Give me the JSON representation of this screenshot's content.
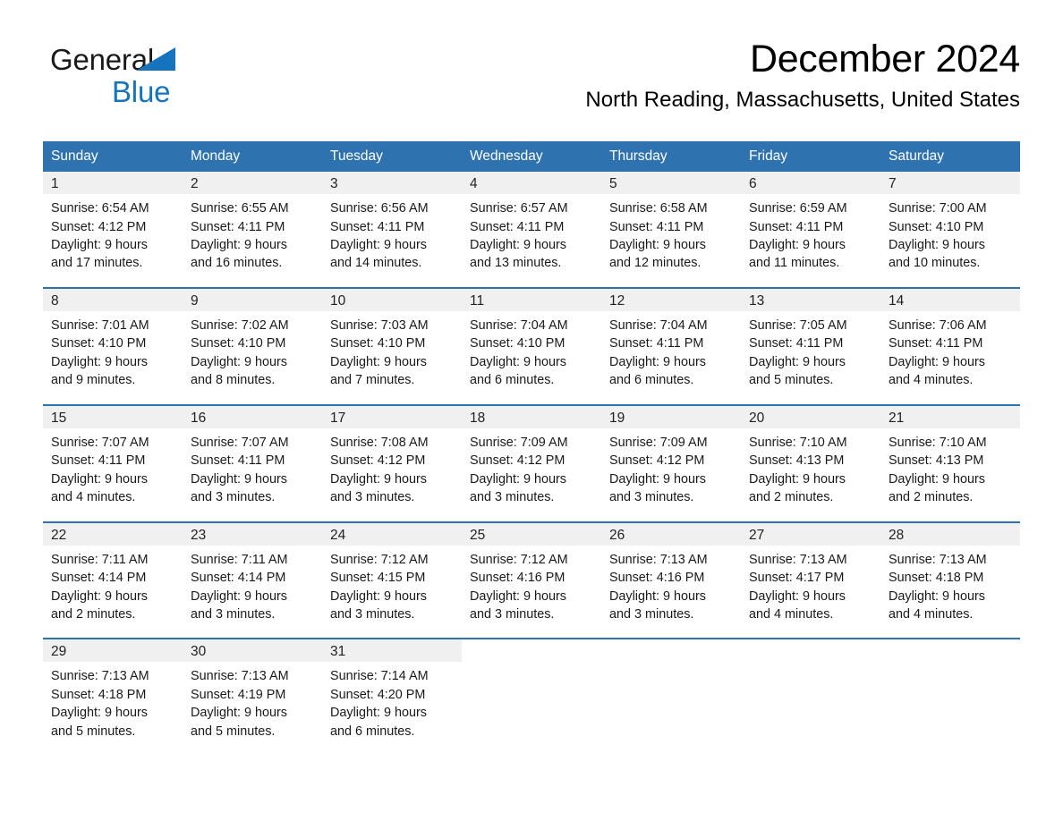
{
  "brand": {
    "name_part1": "General",
    "name_part2": "Blue",
    "triangle_color": "#1574bd"
  },
  "header": {
    "month_title": "December 2024",
    "location": "North Reading, Massachusetts, United States"
  },
  "theme": {
    "header_blue": "#2e72b0",
    "daynum_band": "#f0f0f0",
    "text": "#1a1a1a"
  },
  "calendar": {
    "weekday_headers": [
      "Sunday",
      "Monday",
      "Tuesday",
      "Wednesday",
      "Thursday",
      "Friday",
      "Saturday"
    ],
    "weeks": [
      [
        {
          "day": "1",
          "sunrise": "Sunrise: 6:54 AM",
          "sunset": "Sunset: 4:12 PM",
          "daylight_line1": "Daylight: 9 hours",
          "daylight_line2": "and 17 minutes."
        },
        {
          "day": "2",
          "sunrise": "Sunrise: 6:55 AM",
          "sunset": "Sunset: 4:11 PM",
          "daylight_line1": "Daylight: 9 hours",
          "daylight_line2": "and 16 minutes."
        },
        {
          "day": "3",
          "sunrise": "Sunrise: 6:56 AM",
          "sunset": "Sunset: 4:11 PM",
          "daylight_line1": "Daylight: 9 hours",
          "daylight_line2": "and 14 minutes."
        },
        {
          "day": "4",
          "sunrise": "Sunrise: 6:57 AM",
          "sunset": "Sunset: 4:11 PM",
          "daylight_line1": "Daylight: 9 hours",
          "daylight_line2": "and 13 minutes."
        },
        {
          "day": "5",
          "sunrise": "Sunrise: 6:58 AM",
          "sunset": "Sunset: 4:11 PM",
          "daylight_line1": "Daylight: 9 hours",
          "daylight_line2": "and 12 minutes."
        },
        {
          "day": "6",
          "sunrise": "Sunrise: 6:59 AM",
          "sunset": "Sunset: 4:11 PM",
          "daylight_line1": "Daylight: 9 hours",
          "daylight_line2": "and 11 minutes."
        },
        {
          "day": "7",
          "sunrise": "Sunrise: 7:00 AM",
          "sunset": "Sunset: 4:10 PM",
          "daylight_line1": "Daylight: 9 hours",
          "daylight_line2": "and 10 minutes."
        }
      ],
      [
        {
          "day": "8",
          "sunrise": "Sunrise: 7:01 AM",
          "sunset": "Sunset: 4:10 PM",
          "daylight_line1": "Daylight: 9 hours",
          "daylight_line2": "and 9 minutes."
        },
        {
          "day": "9",
          "sunrise": "Sunrise: 7:02 AM",
          "sunset": "Sunset: 4:10 PM",
          "daylight_line1": "Daylight: 9 hours",
          "daylight_line2": "and 8 minutes."
        },
        {
          "day": "10",
          "sunrise": "Sunrise: 7:03 AM",
          "sunset": "Sunset: 4:10 PM",
          "daylight_line1": "Daylight: 9 hours",
          "daylight_line2": "and 7 minutes."
        },
        {
          "day": "11",
          "sunrise": "Sunrise: 7:04 AM",
          "sunset": "Sunset: 4:10 PM",
          "daylight_line1": "Daylight: 9 hours",
          "daylight_line2": "and 6 minutes."
        },
        {
          "day": "12",
          "sunrise": "Sunrise: 7:04 AM",
          "sunset": "Sunset: 4:11 PM",
          "daylight_line1": "Daylight: 9 hours",
          "daylight_line2": "and 6 minutes."
        },
        {
          "day": "13",
          "sunrise": "Sunrise: 7:05 AM",
          "sunset": "Sunset: 4:11 PM",
          "daylight_line1": "Daylight: 9 hours",
          "daylight_line2": "and 5 minutes."
        },
        {
          "day": "14",
          "sunrise": "Sunrise: 7:06 AM",
          "sunset": "Sunset: 4:11 PM",
          "daylight_line1": "Daylight: 9 hours",
          "daylight_line2": "and 4 minutes."
        }
      ],
      [
        {
          "day": "15",
          "sunrise": "Sunrise: 7:07 AM",
          "sunset": "Sunset: 4:11 PM",
          "daylight_line1": "Daylight: 9 hours",
          "daylight_line2": "and 4 minutes."
        },
        {
          "day": "16",
          "sunrise": "Sunrise: 7:07 AM",
          "sunset": "Sunset: 4:11 PM",
          "daylight_line1": "Daylight: 9 hours",
          "daylight_line2": "and 3 minutes."
        },
        {
          "day": "17",
          "sunrise": "Sunrise: 7:08 AM",
          "sunset": "Sunset: 4:12 PM",
          "daylight_line1": "Daylight: 9 hours",
          "daylight_line2": "and 3 minutes."
        },
        {
          "day": "18",
          "sunrise": "Sunrise: 7:09 AM",
          "sunset": "Sunset: 4:12 PM",
          "daylight_line1": "Daylight: 9 hours",
          "daylight_line2": "and 3 minutes."
        },
        {
          "day": "19",
          "sunrise": "Sunrise: 7:09 AM",
          "sunset": "Sunset: 4:12 PM",
          "daylight_line1": "Daylight: 9 hours",
          "daylight_line2": "and 3 minutes."
        },
        {
          "day": "20",
          "sunrise": "Sunrise: 7:10 AM",
          "sunset": "Sunset: 4:13 PM",
          "daylight_line1": "Daylight: 9 hours",
          "daylight_line2": "and 2 minutes."
        },
        {
          "day": "21",
          "sunrise": "Sunrise: 7:10 AM",
          "sunset": "Sunset: 4:13 PM",
          "daylight_line1": "Daylight: 9 hours",
          "daylight_line2": "and 2 minutes."
        }
      ],
      [
        {
          "day": "22",
          "sunrise": "Sunrise: 7:11 AM",
          "sunset": "Sunset: 4:14 PM",
          "daylight_line1": "Daylight: 9 hours",
          "daylight_line2": "and 2 minutes."
        },
        {
          "day": "23",
          "sunrise": "Sunrise: 7:11 AM",
          "sunset": "Sunset: 4:14 PM",
          "daylight_line1": "Daylight: 9 hours",
          "daylight_line2": "and 3 minutes."
        },
        {
          "day": "24",
          "sunrise": "Sunrise: 7:12 AM",
          "sunset": "Sunset: 4:15 PM",
          "daylight_line1": "Daylight: 9 hours",
          "daylight_line2": "and 3 minutes."
        },
        {
          "day": "25",
          "sunrise": "Sunrise: 7:12 AM",
          "sunset": "Sunset: 4:16 PM",
          "daylight_line1": "Daylight: 9 hours",
          "daylight_line2": "and 3 minutes."
        },
        {
          "day": "26",
          "sunrise": "Sunrise: 7:13 AM",
          "sunset": "Sunset: 4:16 PM",
          "daylight_line1": "Daylight: 9 hours",
          "daylight_line2": "and 3 minutes."
        },
        {
          "day": "27",
          "sunrise": "Sunrise: 7:13 AM",
          "sunset": "Sunset: 4:17 PM",
          "daylight_line1": "Daylight: 9 hours",
          "daylight_line2": "and 4 minutes."
        },
        {
          "day": "28",
          "sunrise": "Sunrise: 7:13 AM",
          "sunset": "Sunset: 4:18 PM",
          "daylight_line1": "Daylight: 9 hours",
          "daylight_line2": "and 4 minutes."
        }
      ],
      [
        {
          "day": "29",
          "sunrise": "Sunrise: 7:13 AM",
          "sunset": "Sunset: 4:18 PM",
          "daylight_line1": "Daylight: 9 hours",
          "daylight_line2": "and 5 minutes."
        },
        {
          "day": "30",
          "sunrise": "Sunrise: 7:13 AM",
          "sunset": "Sunset: 4:19 PM",
          "daylight_line1": "Daylight: 9 hours",
          "daylight_line2": "and 5 minutes."
        },
        {
          "day": "31",
          "sunrise": "Sunrise: 7:14 AM",
          "sunset": "Sunset: 4:20 PM",
          "daylight_line1": "Daylight: 9 hours",
          "daylight_line2": "and 6 minutes."
        },
        {
          "day": "",
          "sunrise": "",
          "sunset": "",
          "daylight_line1": "",
          "daylight_line2": ""
        },
        {
          "day": "",
          "sunrise": "",
          "sunset": "",
          "daylight_line1": "",
          "daylight_line2": ""
        },
        {
          "day": "",
          "sunrise": "",
          "sunset": "",
          "daylight_line1": "",
          "daylight_line2": ""
        },
        {
          "day": "",
          "sunrise": "",
          "sunset": "",
          "daylight_line1": "",
          "daylight_line2": ""
        }
      ]
    ]
  }
}
